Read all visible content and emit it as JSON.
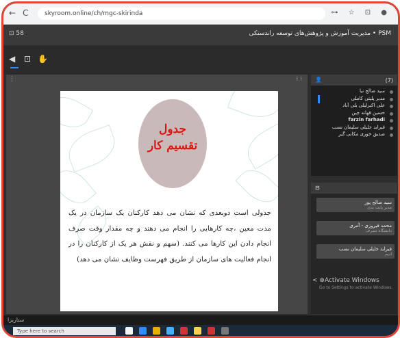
{
  "browser": {
    "url": "skyroom.online/ch/mgc-skirinda",
    "nav_back": "←",
    "nav_refresh": "C",
    "icons": "⊶ ☆ ⊡ ●"
  },
  "app": {
    "title": "PSM • مدیریت آموزش و پژوهش‌های توسعه راندستکی",
    "left_label": "⊡ 58"
  },
  "toolbar": {
    "icons": [
      "speaker-icon",
      "screen-icon",
      "hand-icon"
    ]
  },
  "stage": {
    "menu": "⋮",
    "ctrl": "⁝ ⁝"
  },
  "slide": {
    "title_line1": "جدول",
    "title_line2": "تقسیم کار",
    "body": "جدولی است دوبعدی که نشان می دهد کارکنان یک سازمان در یک مدت معین ،چه کارهایی را انجام می دهند و چه مقدار وقت صرف انجام دادن این کارها می کنند. (سهم و نقش هر یک از کارکنان را در انجام فعالیت های سازمان از طریق فهرست وظایف نشان می دهد)"
  },
  "participants": {
    "header_count": "(7)",
    "items": [
      "سید صالح نیا",
      "مدیر پلیتی کاملی",
      "علی اکبرلیلی بلی آباد",
      "حسین قهانه چین",
      "farzin farhadi",
      "فیراید جلیلی سلیمان نسب",
      "صدیق خوری مکانی گیر"
    ]
  },
  "chat": {
    "messages": [
      {
        "name": "سید صالح پور",
        "sub": "مدیر پایت بدی"
      },
      {
        "name": "محمد فیروزی - آمری",
        "sub": "دانشگاه تصرف"
      },
      {
        "name": "فیراید جلیلی سلیمان نسب",
        "sub": "ادیم"
      }
    ],
    "activate_title": "< ⊕Activate Windows",
    "activate_sub": "Go to Settings to activate Windows."
  },
  "footer": {
    "label": "ستاریزا"
  },
  "taskbar": {
    "search_placeholder": "Type here to search",
    "colors": [
      "#f5f5f5",
      "#2d8cff",
      "#e7b100",
      "#44b0ff",
      "#d13438",
      "#ffd24a",
      "#c33",
      "#777"
    ]
  }
}
